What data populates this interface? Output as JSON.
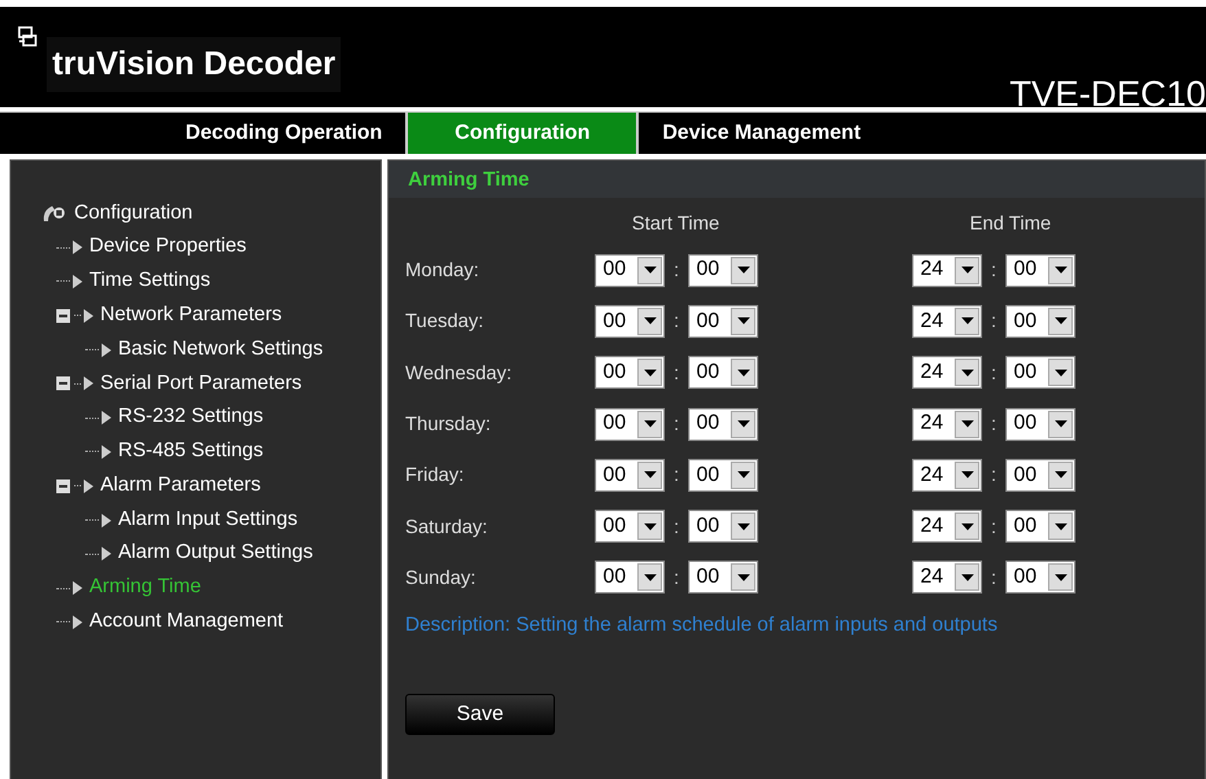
{
  "header": {
    "title": "truVision Decoder",
    "model": "TVE-DEC10"
  },
  "nav_tabs": [
    {
      "label": "Decoding Operation",
      "selected": false
    },
    {
      "label": "Configuration",
      "selected": true
    },
    {
      "label": "Device Management",
      "selected": false
    }
  ],
  "sidebar": {
    "root": "Configuration",
    "items": [
      {
        "label": "Device Properties",
        "selected": false
      },
      {
        "label": "Time Settings",
        "selected": false
      },
      {
        "label": "Network Parameters",
        "selected": false,
        "expanded": true,
        "children": [
          {
            "label": "Basic Network Settings",
            "selected": false
          }
        ]
      },
      {
        "label": "Serial Port Parameters",
        "selected": false,
        "expanded": true,
        "children": [
          {
            "label": "RS-232 Settings",
            "selected": false
          },
          {
            "label": "RS-485 Settings",
            "selected": false
          }
        ]
      },
      {
        "label": "Alarm Parameters",
        "selected": false,
        "expanded": true,
        "children": [
          {
            "label": "Alarm Input Settings",
            "selected": false
          },
          {
            "label": "Alarm Output Settings",
            "selected": false
          }
        ]
      },
      {
        "label": "Arming Time",
        "selected": true
      },
      {
        "label": "Account Management",
        "selected": false
      }
    ]
  },
  "panel": {
    "title": "Arming Time",
    "columns": [
      "Start Time",
      "End Time"
    ],
    "rows": [
      {
        "day": "Monday:",
        "start_hour": "00",
        "start_min": "00",
        "end_hour": "24",
        "end_min": "00"
      },
      {
        "day": "Tuesday:",
        "start_hour": "00",
        "start_min": "00",
        "end_hour": "24",
        "end_min": "00"
      },
      {
        "day": "Wednesday:",
        "start_hour": "00",
        "start_min": "00",
        "end_hour": "24",
        "end_min": "00"
      },
      {
        "day": "Thursday:",
        "start_hour": "00",
        "start_min": "00",
        "end_hour": "24",
        "end_min": "00"
      },
      {
        "day": "Friday:",
        "start_hour": "00",
        "start_min": "00",
        "end_hour": "24",
        "end_min": "00"
      },
      {
        "day": "Saturday:",
        "start_hour": "00",
        "start_min": "00",
        "end_hour": "24",
        "end_min": "00"
      },
      {
        "day": "Sunday:",
        "start_hour": "00",
        "start_min": "00",
        "end_hour": "24",
        "end_min": "00"
      }
    ],
    "separator": ":",
    "description": "Description: Setting the alarm schedule of alarm inputs and outputs",
    "save_button": "Save"
  }
}
